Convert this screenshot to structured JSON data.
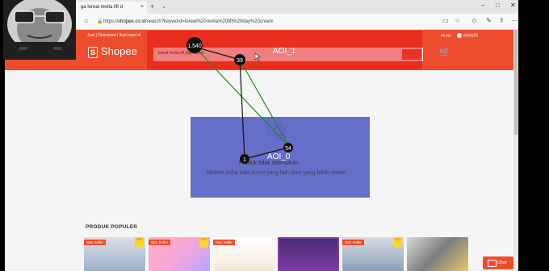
{
  "browser": {
    "tab_title": "ga loreal revita lift d",
    "tab_close": "×",
    "new_tab": "+",
    "tab_menu": "⌄",
    "minimize": "–",
    "maximize": "□",
    "close": "✕",
    "url_prefix": "https://",
    "url_domain": "shopee.co.id",
    "url_rest": "/search?keyword=loreal%20revita%20lift%20day%20cream"
  },
  "header": {
    "top_links": "Jual | Download | Ikuti kami di",
    "top_right": "ntuan",
    "username": "dwilla25",
    "logo_text": "Shopee",
    "search_value": "loreal revita lift day cream",
    "cart_icon": "cart-icon"
  },
  "aoi": [
    {
      "label": "AOI_1",
      "color": "#e61414"
    },
    {
      "label": "AOI_0",
      "color": "#4650be"
    }
  ],
  "fixations": [
    {
      "label": "1.540"
    },
    {
      "label": "39"
    },
    {
      "label": "54"
    },
    {
      "label": "1"
    }
  ],
  "empty_state": {
    "title": "Produk tidak ditemukan",
    "subtitle": "Mohon coba kata kunci yang lain atau yang lebih umum"
  },
  "popular": {
    "title": "PRODUK POPULER",
    "badge": "Star Seller",
    "off": "53%"
  },
  "chat": {
    "label": "Chat"
  }
}
